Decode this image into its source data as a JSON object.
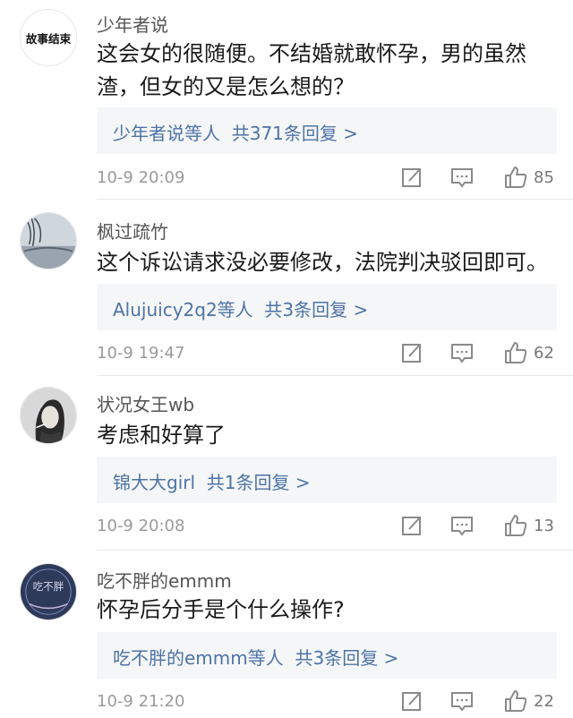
{
  "comments": [
    {
      "username": "少年者说",
      "avatar_text": "故事结束",
      "content": "这会女的很随便。不结婚就敢怀孕，男的虽然渣，但女的又是怎么想的？",
      "reply_users": "少年者说等人",
      "reply_count": "共371条回复 >",
      "time": "10-9 20:09",
      "likes": "85"
    },
    {
      "username": "枫过疏竹",
      "avatar_text": "",
      "content": "这个诉讼请求没必要修改，法院判决驳回即可。",
      "reply_users": "Alujuicy2q2等人",
      "reply_count": "共3条回复 >",
      "time": "10-9 19:47",
      "likes": "62"
    },
    {
      "username": "状况女王wb",
      "avatar_text": "",
      "content": "考虑和好算了",
      "reply_users": "锦大大girl",
      "reply_count": "共1条回复 >",
      "time": "10-9 20:08",
      "likes": "13"
    },
    {
      "username": "吃不胖的emmm",
      "avatar_text": "吃不胖",
      "content": "怀孕后分手是个什么操作?",
      "reply_users": "吃不胖的emmm等人",
      "reply_count": "共3条回复 >",
      "time": "10-9 21:20",
      "likes": "22"
    }
  ],
  "colors": {
    "link": "#4d73a6",
    "meta": "#9a9a9a",
    "reply_bg": "#f5f6f8",
    "icon": "#8a8a8a"
  },
  "icons": [
    "share-icon",
    "comment-icon",
    "like-icon"
  ]
}
